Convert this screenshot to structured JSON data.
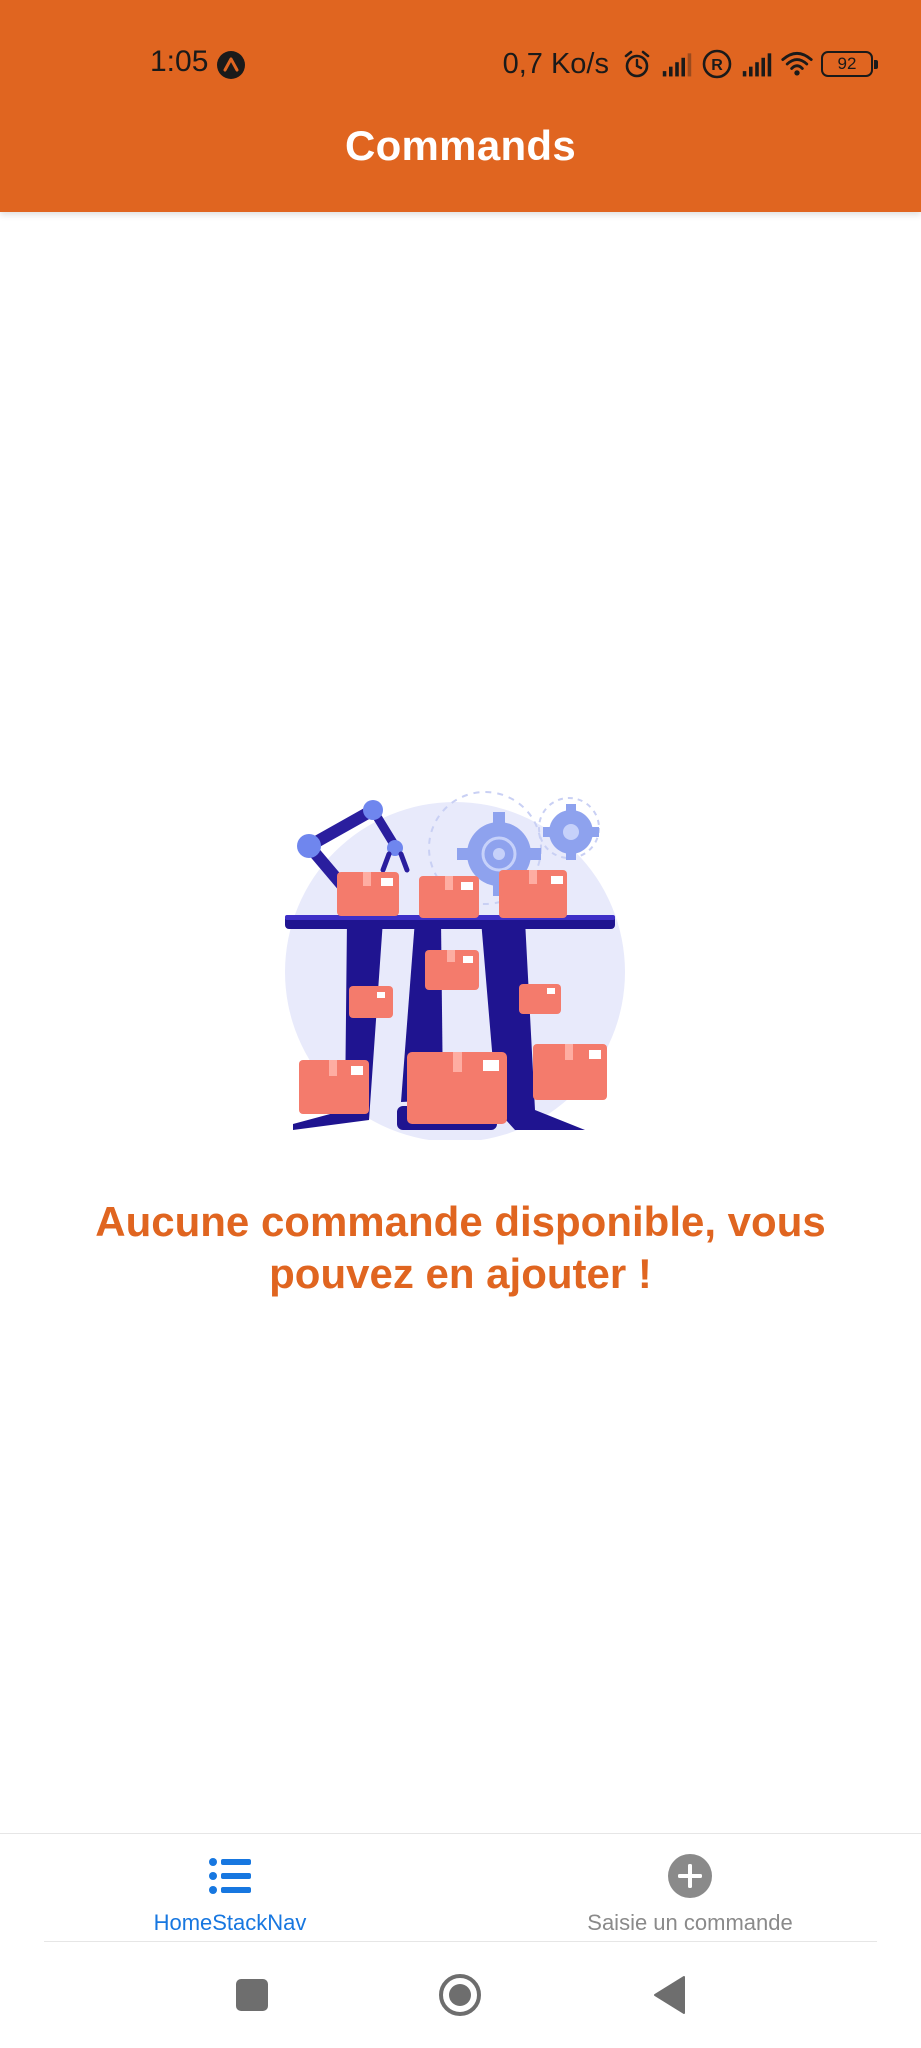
{
  "status_bar": {
    "time": "1:05",
    "network_speed": "0,7 Ko/s",
    "battery_level": "92",
    "icons": [
      "app-notification-icon",
      "alarm-icon",
      "signal-icon",
      "roaming-icon",
      "signal-icon",
      "wifi-icon",
      "battery-icon"
    ]
  },
  "header": {
    "title": "Commands",
    "background_color": "#E06520"
  },
  "empty_state": {
    "illustration": "factory-conveyor-illustration",
    "message": "Aucune commande disponible, vous pouvez en ajouter !",
    "message_color": "#E06520"
  },
  "tab_bar": {
    "tabs": [
      {
        "label": "HomeStackNav",
        "icon": "list-icon",
        "active": true,
        "color": "#1777E0"
      },
      {
        "label": "Saisie un commande",
        "icon": "plus-circle-icon",
        "active": false,
        "color": "#8a8a8a"
      }
    ]
  },
  "system_nav": {
    "buttons": [
      "recents-button",
      "home-button",
      "back-button"
    ]
  }
}
